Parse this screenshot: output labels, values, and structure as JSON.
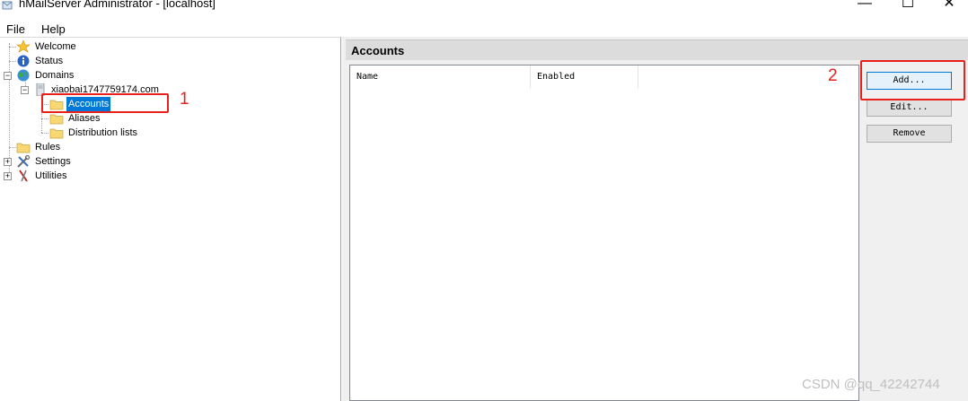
{
  "window": {
    "title": "hMailServer Administrator - [localhost]",
    "controls": {
      "minimize": "—",
      "maximize": "☐",
      "close": "✕"
    }
  },
  "menu": {
    "file": "File",
    "help": "Help"
  },
  "tree": {
    "welcome": "Welcome",
    "status": "Status",
    "domains": "Domains",
    "domain_name": "xiaobai1747759174.com",
    "accounts": "Accounts",
    "aliases": "Aliases",
    "distribution_lists": "Distribution lists",
    "rules": "Rules",
    "settings": "Settings",
    "utilities": "Utilities"
  },
  "panel": {
    "title": "Accounts",
    "columns": [
      "Name",
      "Enabled"
    ],
    "buttons": {
      "add": "Add...",
      "edit": "Edit...",
      "remove": "Remove"
    }
  },
  "annotations": {
    "step1": "1",
    "step2": "2",
    "color": "#e8211c"
  },
  "watermark": "CSDN @qq_42242744",
  "colors": {
    "selection": "#0078d7",
    "panel_bg": "#f0f0f0",
    "header_bg": "#dcdcdc"
  }
}
